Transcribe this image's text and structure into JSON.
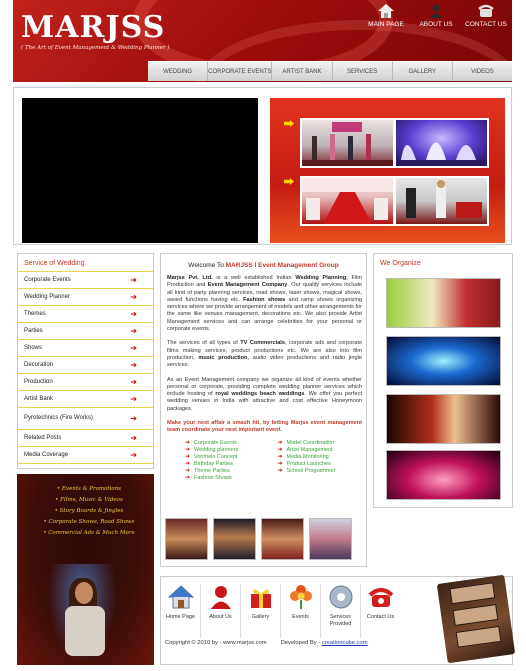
{
  "header": {
    "logo": "MARJSS",
    "tagline": "( The Art of Event Management & Wedding Planner )",
    "top_nav": [
      {
        "label": "MAIN PAGE",
        "icon": "house-icon"
      },
      {
        "label": "ABOUT US",
        "icon": "person-icon"
      },
      {
        "label": "CONTACT US",
        "icon": "phone-icon"
      }
    ],
    "main_nav": [
      "WEDDING",
      "CORPORATE EVENTS",
      "ARTIST BANK",
      "SERVICES",
      "GALLERY",
      "VIDEOS"
    ]
  },
  "services_box": {
    "title": "Service of Wedding",
    "items": [
      "Corporate Events",
      "Wedding Planner",
      "Themes",
      "Parties",
      "Shows",
      "Decoration",
      "Production",
      "Artist Bank",
      "Pyrotechnics (Fire Works)",
      "Related Posts",
      "Media Coverage"
    ]
  },
  "promo": {
    "lines": [
      "• Events & Promotions",
      "• Films, Music & Videos",
      "• Story Boards & Jingles",
      "• Corporate Shows, Road Shows",
      "• Commercial Ads & Much More"
    ]
  },
  "welcome": {
    "title_prefix": "Welcome To ",
    "title_brand": "MARJSS I Event Management Group",
    "p1": {
      "a": "Marjss Pvt. Ltd.",
      "b": " is a well established Indian ",
      "c": "Wedding Planning",
      "d": ", Film Production and ",
      "e": "Event Management Company",
      "f": ". Our quality services include all kind of party planning services, road shows, laser shows, magical shows, award functions having etc. ",
      "g": "Fashion shows",
      "h": " and ramp shows organizing services where we provide arrangement of models and other arrangements for the same like venues management, decorations etc. We also provide Artist Management services and can arrange celebrities for your personal or corporate events."
    },
    "p2": {
      "a": "The services of all types of ",
      "b": "TV Commercials",
      "c": ", corporate ads and corporate films making services, product productions etc. We are also into film production, ",
      "d": "music production",
      "e": ", audio video productions and radio jingle services."
    },
    "p3": {
      "a": "As an Event Management company we organize all kind of events whether personal or corporate, providing complete wedding planner services which include hosting of ",
      "b": "royal weddings beach weddings",
      "c": ". We offer you perfect wedding venues in India with attractive and cost effective Honeymoon packages."
    },
    "closing": "Make your next affair a smash hit, by letting Marjss event management team coordinate your next important event.",
    "service_links_left": [
      "Corporate Events",
      "Wedding planners",
      "Vonmelo Concept",
      "Birthday Parties",
      "Theme Parties",
      "Fashion Shows"
    ],
    "service_links_right": [
      "Model Coordination",
      "Artist Management",
      "Media Monitoring",
      "Product Launches",
      "School Programmer"
    ]
  },
  "organise": {
    "title": "We Organize"
  },
  "footer": {
    "nav": [
      {
        "label": "Home Page",
        "icon": "house-icon"
      },
      {
        "label": "About Us",
        "icon": "person-icon"
      },
      {
        "label": "Gallery",
        "icon": "gift-icon"
      },
      {
        "label": "Events",
        "icon": "flower-icon"
      },
      {
        "label": "Services Provided",
        "icon": "disc-icon"
      },
      {
        "label": "Contact Us",
        "icon": "phone-icon"
      }
    ],
    "copyright": "Copyright © 2010 by - www.marjss.com",
    "developed_by_label": "Developed By - ",
    "developer": "creationcube.com"
  },
  "colors": {
    "brand_red": "#b5140f",
    "accent_red": "#c0392b",
    "link_green": "#3aa03a",
    "divider_yellow": "#e8d44d"
  }
}
